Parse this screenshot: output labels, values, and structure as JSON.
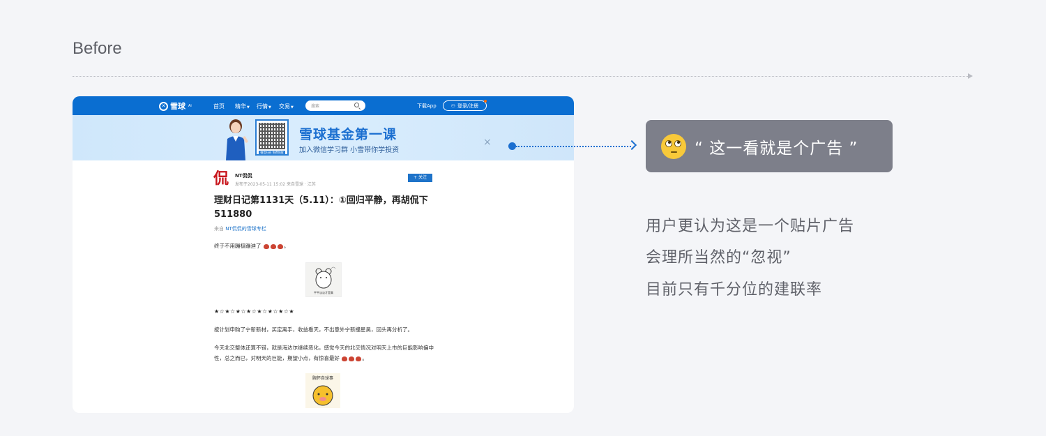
{
  "heading": "Before",
  "app": {
    "logo_text": "雪球",
    "logo_sup": "Ai",
    "nav": [
      "首页",
      "精华",
      "行情",
      "交易"
    ],
    "search_placeholder": "搜索",
    "download": "下载App",
    "login": "登录/注册"
  },
  "banner": {
    "title": "雪球基金第一课",
    "subtitle": "加入微信学习群 小雪带你学投资",
    "qr_caption": "微信扫码 免费领取",
    "close_icon": "×"
  },
  "article": {
    "avatar_char": "侃",
    "author": "NT侃侃",
    "meta": "发布于2023-05-11 15:02 来自雪球 · 江苏",
    "follow": "+ 关注",
    "title": "理财日记第1131天（5.11）：①回归平静，再胡侃下511880",
    "source_prefix": "来自",
    "source_link": "NT侃侃的雪球专栏",
    "para1": "终于不用蹦极蹦迪了",
    "sticker1_caption": "平平淡淡才是真",
    "stars": "★☆★☆★☆★☆★☆★☆★☆★",
    "para2": "按计划申购了宁新新材，买定离手，收益看天，不出意外宁新撞星昊，回头再分析了。",
    "para3": "今天北交整体还算不错，就是海达尔继续恶化，感觉今天的北交情况对明天上市的巨能影响偏中性，总之而已，对明天的巨能，期望小点，有惊喜最好",
    "sticker2_caption": "胸怀自球事"
  },
  "callout": {
    "quote": "“ 这一看就是个广告 ”",
    "emoji": "rolling-eyes-face-icon"
  },
  "explanation": [
    "用户更认为这是一个贴片广告",
    "会理所当然的“忽视”",
    "目前只有千分位的建联率"
  ],
  "colors": {
    "nav_blue": "#0a6ed1",
    "banner_blue": "#1b6fd0",
    "callout_bg": "#7d7f8a",
    "page_bg": "#f4f5f8"
  }
}
